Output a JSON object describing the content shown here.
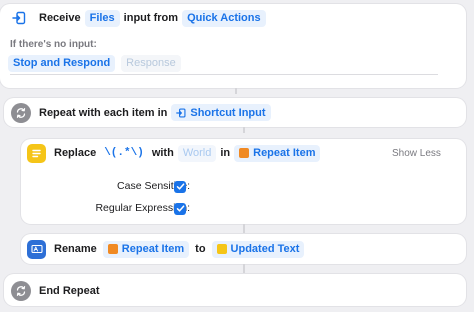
{
  "receive": {
    "word": "Receive",
    "type_token": "Files",
    "middle_text": "input from",
    "source_token": "Quick Actions",
    "no_input_label": "If there's no input:",
    "stop_button": "Stop and Respond",
    "response_placeholder": "Response"
  },
  "repeat": {
    "title": "Repeat with each item in",
    "input_token": "Shortcut Input"
  },
  "replace": {
    "word": "Replace",
    "pattern": "\\(.*\\)",
    "with_text": "with",
    "replacement_placeholder": "World",
    "in_text": "in",
    "target_token": "Repeat Item",
    "toggle_label": "Show Less",
    "case_sensitive_label": "Case Sensitive:",
    "case_sensitive_checked": true,
    "regex_label": "Regular Expression:",
    "regex_checked": true
  },
  "rename": {
    "word": "Rename",
    "item_token": "Repeat Item",
    "to_text": "to",
    "new_name_token": "Updated Text"
  },
  "end_repeat": {
    "title": "End Repeat"
  },
  "colors": {
    "accent_blue": "#1a73e8",
    "text_action_yellow": "#f5c518",
    "variable_orange": "#f08a24",
    "scripting_gray": "#8e8e93"
  }
}
